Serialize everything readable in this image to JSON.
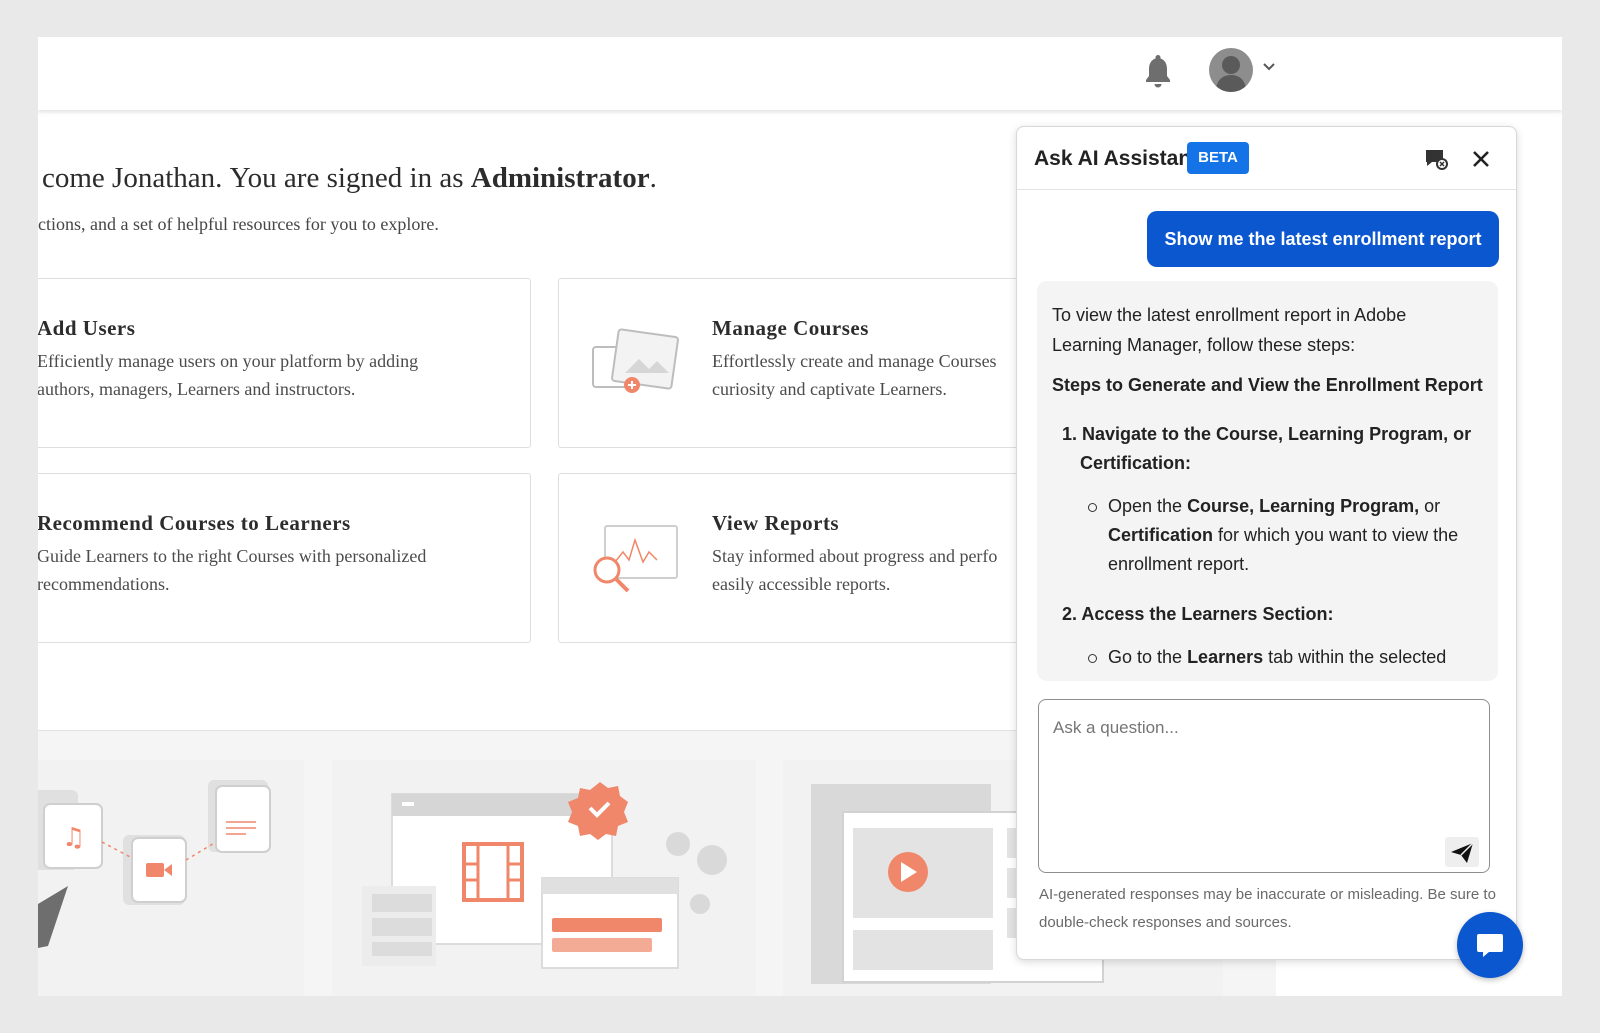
{
  "header": {
    "notifications_icon": "bell-icon",
    "avatar_icon": "user-avatar",
    "menu_icon": "chevron-down-icon"
  },
  "welcome": {
    "greeting": "come Jonathan.",
    "signed_in_prefix": "You are signed in as",
    "role": "Administrator",
    "period": ".",
    "subtitle": "ctions, and a set of helpful resources for you to explore."
  },
  "cards": [
    {
      "title": "Add Users",
      "description": "Efficiently manage users on your platform by adding authors, managers, Learners and instructors."
    },
    {
      "title": "Manage Courses",
      "description": "Effortlessly create and manage Courses to ignite curiosity and captivate Learners.",
      "line1": "Effortlessly create and manage Courses",
      "line2": "curiosity and captivate Learners."
    },
    {
      "title": "Recommend Courses to Learners",
      "description": "Guide Learners to the right Courses with personalized recommendations."
    },
    {
      "title": "View Reports",
      "line1": "Stay informed about progress and perfo",
      "line2": "easily accessible reports."
    }
  ],
  "assistant": {
    "title": "Ask AI Assistant",
    "badge": "BETA",
    "new_chat_icon": "new-chat-icon",
    "close_icon": "close-icon",
    "user_message": "Show me the latest enrollment report",
    "ai": {
      "intro_line1": "To view the latest enrollment report in Adobe",
      "intro_line2": "Learning Manager, follow these steps:",
      "heading": "Steps to Generate and View the Enrollment Report",
      "step1_line1": "1. Navigate to the Course, Learning Program, or",
      "step1_line2": "Certification:",
      "step1_b_open": "Open the ",
      "step1_b_course": "Course, Learning Program,",
      "step1_b_or": " or",
      "step1_b_cert": "Certification",
      "step1_b_rest": " for which you want to view the",
      "step1_b_line3": "enrollment report.",
      "step2": "2. Access the Learners Section:",
      "step2_b_pre": "Go to the ",
      "step2_b_learners": "Learners",
      "step2_b_post": " tab within the selected"
    },
    "input_placeholder": "Ask a question...",
    "send_icon": "send-icon",
    "disclaimer": "AI-generated responses may be inaccurate or misleading. Be sure to double-check responses and sources."
  },
  "chat_button_icon": "chat-bubble-icon",
  "colors": {
    "accent": "#0a57d0",
    "beta": "#1473e6",
    "illustration": "#f0876a"
  }
}
